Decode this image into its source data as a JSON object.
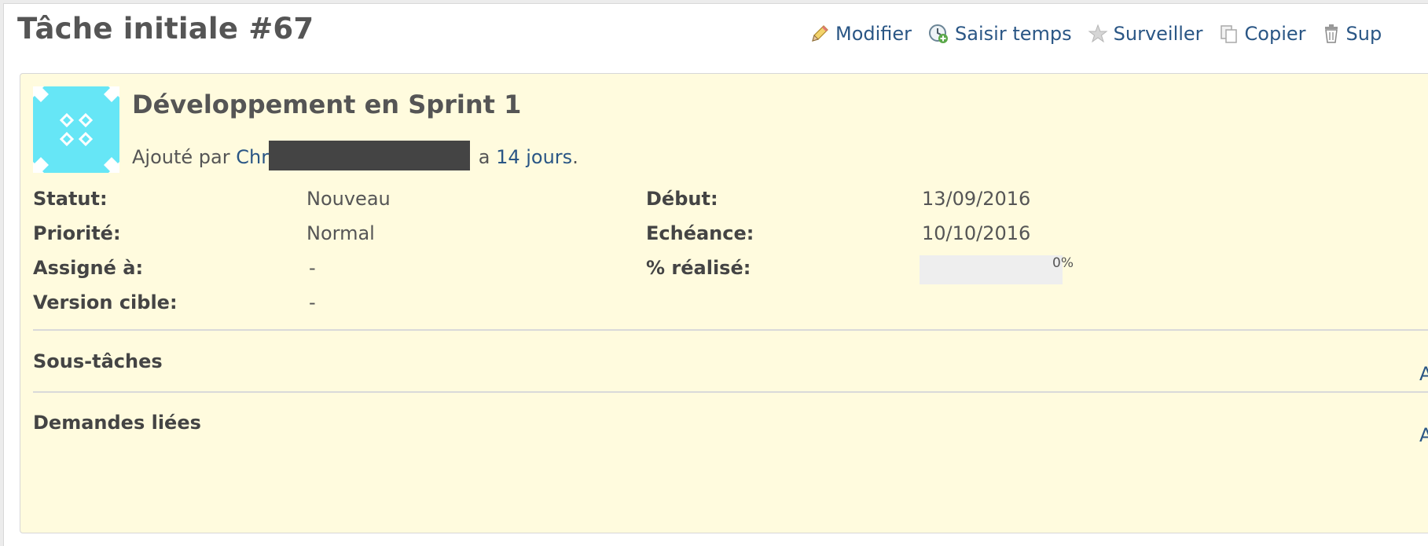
{
  "page": {
    "title": "Tâche initiale #67"
  },
  "toolbar": {
    "items": [
      {
        "label": "Modifier",
        "icon": "pencil-icon"
      },
      {
        "label": "Saisir temps",
        "icon": "clock-add-icon"
      },
      {
        "label": "Surveiller",
        "icon": "star-icon"
      },
      {
        "label": "Copier",
        "icon": "copy-icon"
      },
      {
        "label": "Sup",
        "icon": "trash-icon"
      }
    ]
  },
  "issue": {
    "avatar": {
      "icon": "identicon-avatar",
      "color": "#66e6f6"
    },
    "subject": "Développement en Sprint 1",
    "author": {
      "prefix": "Ajouté par",
      "name_visible": "Chr",
      "age_prefix": "a",
      "age_link": "14 jours",
      "suffix": "."
    },
    "attributes": {
      "left": [
        {
          "label": "Statut:",
          "value": "Nouveau"
        },
        {
          "label": "Priorité:",
          "value": "Normal"
        },
        {
          "label": "Assigné à:",
          "value": "-"
        },
        {
          "label": "Version cible:",
          "value": "-"
        }
      ],
      "right": [
        {
          "label": "Début:",
          "value": "13/09/2016"
        },
        {
          "label": "Echéance:",
          "value": "10/10/2016"
        },
        {
          "label": "% réalisé:",
          "value": "0%"
        }
      ]
    },
    "done_ratio": 0,
    "sections": [
      {
        "title": "Sous-tâches",
        "action": "Aj"
      },
      {
        "title": "Demandes liées",
        "action": "Aj"
      }
    ]
  },
  "colors": {
    "link": "#2a5685",
    "box_background": "#fffbde",
    "progress_empty": "#eeeeee"
  }
}
